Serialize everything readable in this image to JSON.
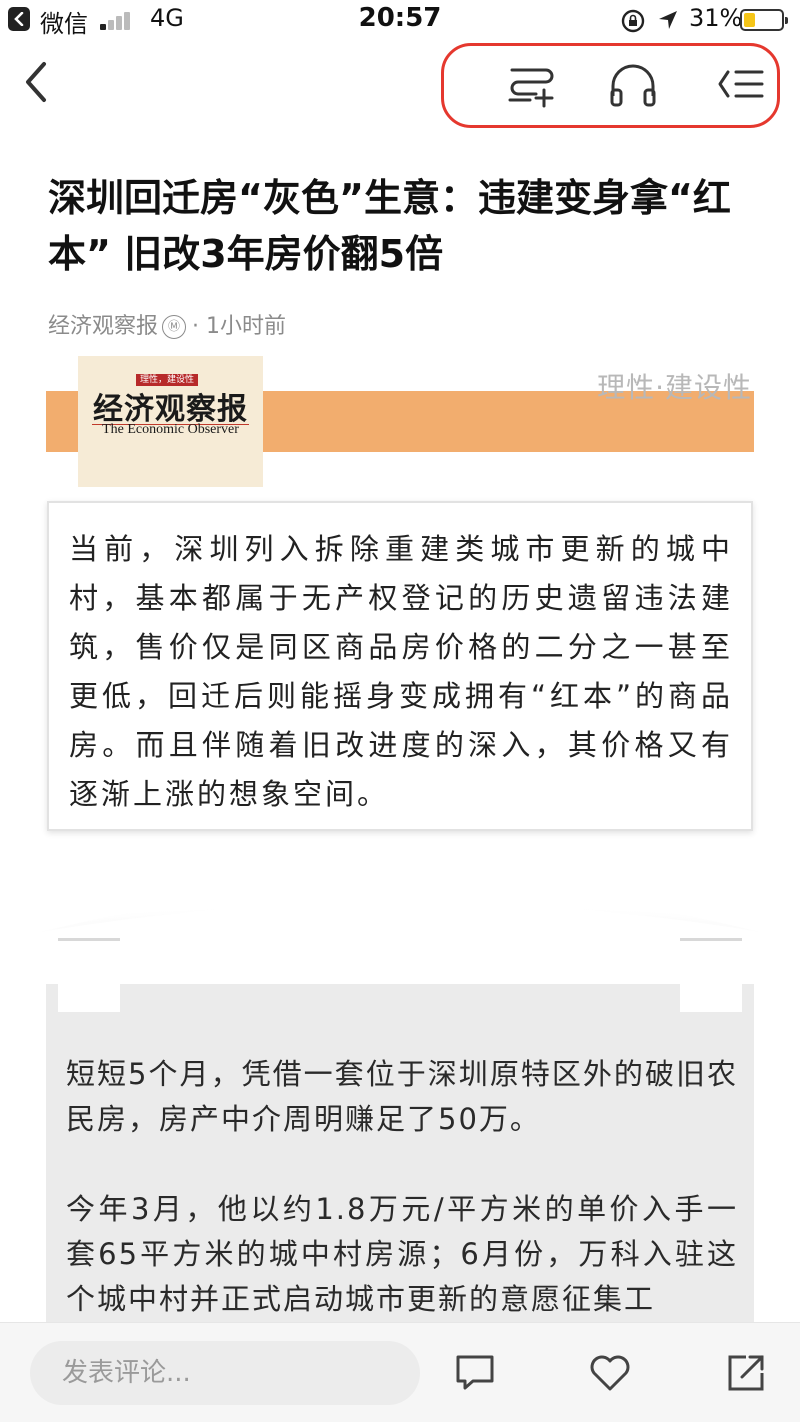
{
  "status_bar": {
    "app_name": "微信",
    "network": "4G",
    "time": "20:57",
    "battery_percent": "31%",
    "battery_level": 0.31,
    "signal_bars_lit": 1
  },
  "nav": {
    "back_icon": "chevron-left-icon",
    "actions": [
      "add-to-list-icon",
      "headphones-icon",
      "toc-icon"
    ],
    "highlight_color": "#e5382e"
  },
  "article": {
    "title": "深圳回迁房“灰色”生意：违建变身拿“红本” 旧改3年房价翻5倍",
    "source": "经济观察报",
    "source_badge": "Ⓜ",
    "separator": "·",
    "time_ago": "1小时前"
  },
  "banner": {
    "logo_tagline": "理性，建设性",
    "logo_cn": "经济观察报",
    "logo_en": "The Economic Observer",
    "slogan": "理性·建设性",
    "bar_color": "#f2ad6e"
  },
  "summary": {
    "text": "当前，深圳列入拆除重建类城市更新的城中村，基本都属于无产权登记的历史遗留违法建筑，售价仅是同区商品房价格的二分之一甚至更低，回迁后则能摇身变成拥有“红本”的商品房。而且伴随着旧改进度的深入，其价格又有逐渐上涨的想象空间。"
  },
  "body": {
    "paragraphs": [
      "短短5个月，凭借一套位于深圳原特区外的破旧农民房，房产中介周明赚足了50万。",
      "今年3月，他以约1.8万元/平方米的单价入手一套65平方米的城中村房源；6月份，万科入驻这个城中村并正式启动城市更新的意愿征集工"
    ]
  },
  "bottom_bar": {
    "comment_placeholder": "发表评论...",
    "icons": [
      "comment-icon",
      "heart-icon",
      "share-icon"
    ]
  }
}
